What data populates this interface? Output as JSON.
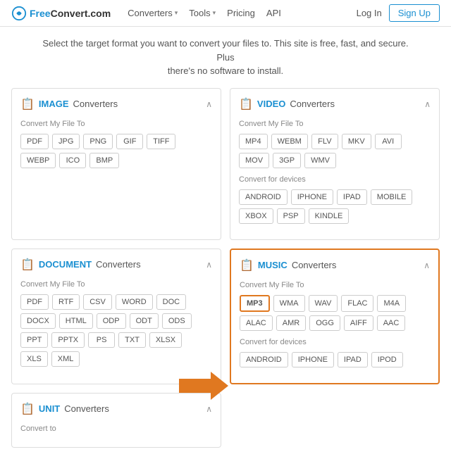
{
  "header": {
    "logo_free": "Free",
    "logo_convert": "Convert.com",
    "nav": [
      {
        "label": "Converters",
        "has_dropdown": true
      },
      {
        "label": "Tools",
        "has_dropdown": true
      },
      {
        "label": "Pricing",
        "has_dropdown": false
      },
      {
        "label": "API",
        "has_dropdown": false
      }
    ],
    "login_label": "Log In",
    "signup_label": "Sign Up"
  },
  "subtitle": {
    "line1": "Select the target format you want to convert your files to. This site is free, fast, and secure. Plus",
    "line2": "there's no software to install."
  },
  "cards": {
    "image": {
      "icon": "📄",
      "title_bold": "IMAGE",
      "title_text": " Converters",
      "section_label": "Convert My File To",
      "formats": [
        "PDF",
        "JPG",
        "PNG",
        "GIF",
        "TIFF",
        "WEBP",
        "ICO",
        "BMP"
      ]
    },
    "video": {
      "icon": "📄",
      "title_bold": "VIDEO",
      "title_text": " Converters",
      "section_label": "Convert My File To",
      "formats": [
        "MP4",
        "WEBM",
        "FLV",
        "MKV",
        "AVI",
        "MOV",
        "3GP",
        "WMV"
      ],
      "devices_label": "Convert for devices",
      "devices": [
        "ANDROID",
        "IPHONE",
        "IPAD",
        "MOBILE",
        "XBOX",
        "PSP",
        "KINDLE"
      ]
    },
    "document": {
      "icon": "📄",
      "title_bold": "DOCUMENT",
      "title_text": " Converters",
      "section_label": "Convert My File To",
      "formats": [
        "PDF",
        "RTF",
        "CSV",
        "WORD",
        "DOC",
        "DOCX",
        "HTML",
        "ODP",
        "ODT",
        "ODS",
        "PPT",
        "PPTX",
        "PS",
        "TXT",
        "XLSX",
        "XLS",
        "XML"
      ]
    },
    "music": {
      "icon": "📄",
      "title_bold": "MUSIC",
      "title_text": " Converters",
      "section_label": "Convert My File To",
      "formats": [
        "MP3",
        "WMA",
        "WAV",
        "FLAC",
        "M4A",
        "ALAC",
        "AMR",
        "OGG",
        "AIFF",
        "AAC"
      ],
      "devices_label": "Convert for devices",
      "devices": [
        "ANDROID",
        "IPHONE",
        "IPAD",
        "IPOD"
      ]
    },
    "unit": {
      "icon": "📄",
      "title_bold": "UNIT",
      "title_text": " Converters",
      "section_label": "Convert to"
    }
  }
}
